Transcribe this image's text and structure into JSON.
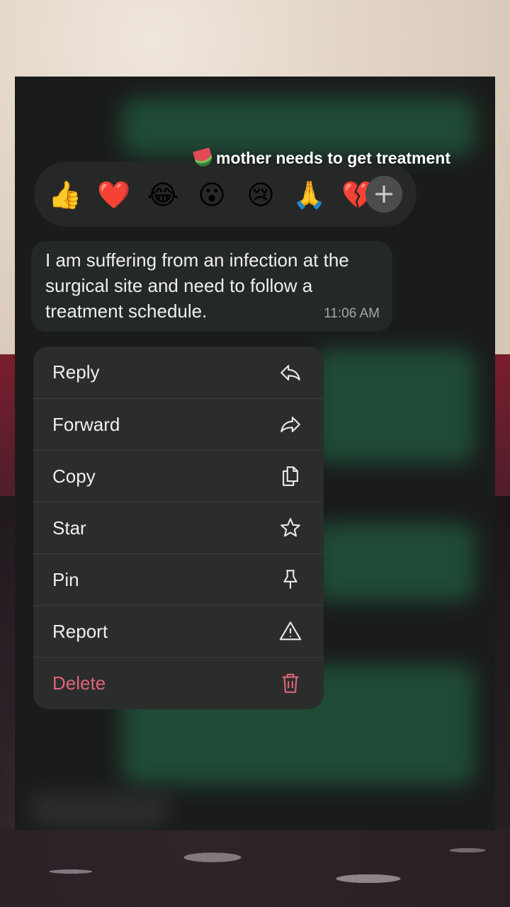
{
  "caption": {
    "text": "mother needs to get treatment"
  },
  "reactions": [
    "👍",
    "❤️",
    "😂",
    "😮",
    "😢",
    "🙏",
    "💔"
  ],
  "add_reaction_label": "+",
  "message": {
    "text": "I am suffering from an infection at the surgical site and need to follow a treatment schedule.",
    "time": "11:06 AM"
  },
  "menu": {
    "reply": "Reply",
    "forward": "Forward",
    "copy": "Copy",
    "star": "Star",
    "pin": "Pin",
    "report": "Report",
    "delete": "Delete"
  },
  "colors": {
    "danger": "#e0637a",
    "menu_bg": "#2b2d2c",
    "bubble_bg": "#242826"
  }
}
